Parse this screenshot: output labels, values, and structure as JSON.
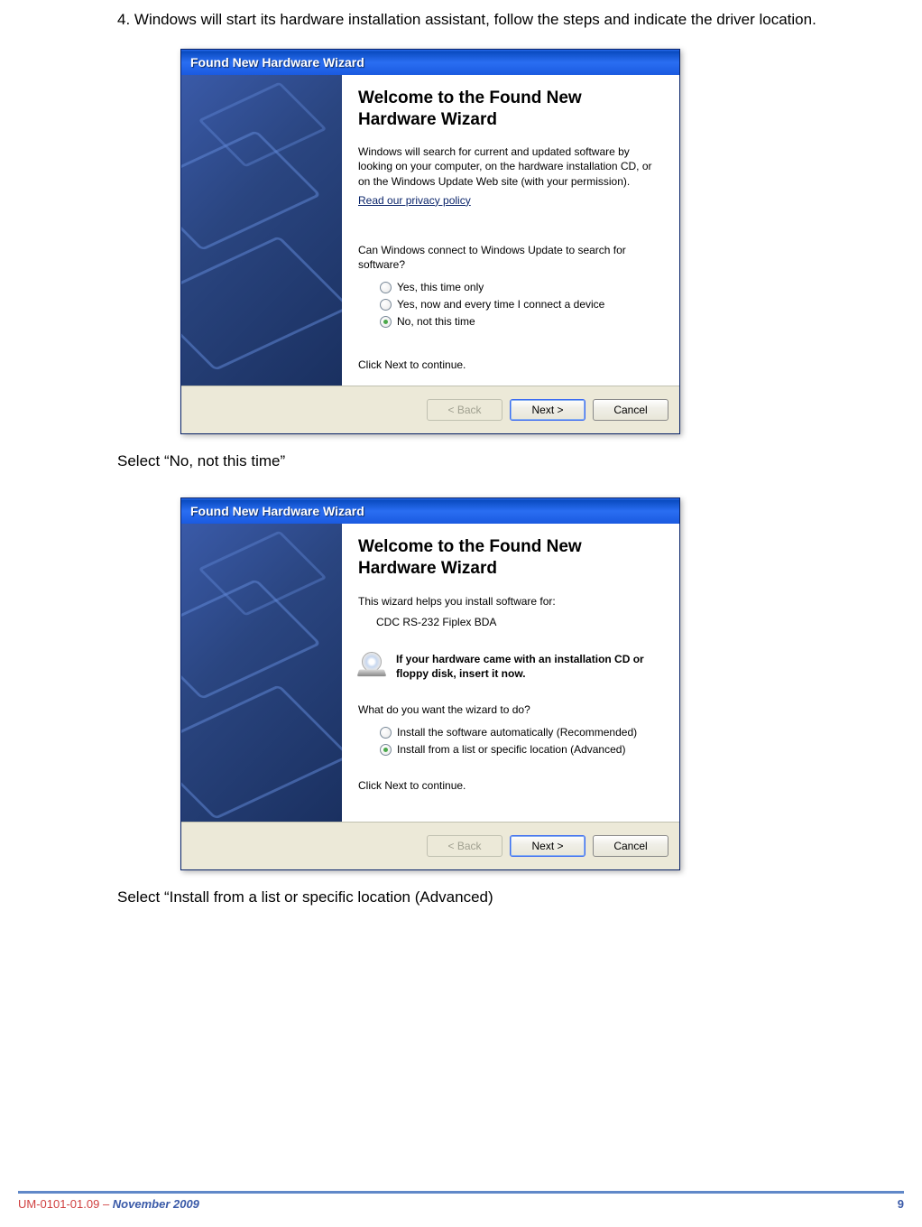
{
  "instruction_step4": "4. Windows will start its hardware installation assistant, follow the steps and indicate the driver location.",
  "caption1": "Select “No, not this time”",
  "caption2": "Select “Install from a list or specific location (Advanced)",
  "dialog1": {
    "title": "Found New Hardware Wizard",
    "heading": "Welcome to the Found New Hardware Wizard",
    "intro": "Windows will search for current and updated software by looking on your computer, on the hardware installation CD, or on the Windows Update Web site (with your permission).",
    "privacy_link": "Read our privacy policy",
    "question": "Can Windows connect to Windows Update to search for software?",
    "options": [
      {
        "label": "Yes, this time only",
        "selected": false
      },
      {
        "label": "Yes, now and every time I connect a device",
        "selected": false
      },
      {
        "label": "No, not this time",
        "selected": true
      }
    ],
    "continue": "Click Next to continue.",
    "buttons": {
      "back": "< Back",
      "next": "Next >",
      "cancel": "Cancel"
    }
  },
  "dialog2": {
    "title": "Found New Hardware Wizard",
    "heading": "Welcome to the Found New Hardware Wizard",
    "intro": "This wizard helps you install software for:",
    "device": "CDC RS-232 Fiplex BDA",
    "cd_prompt": "If your hardware came with an installation CD or floppy disk, insert it now.",
    "question": "What do you want the wizard to do?",
    "options": [
      {
        "label": "Install the software automatically (Recommended)",
        "selected": false
      },
      {
        "label": "Install from a list or specific location (Advanced)",
        "selected": true
      }
    ],
    "continue": "Click Next to continue.",
    "buttons": {
      "back": "< Back",
      "next": "Next >",
      "cancel": "Cancel"
    }
  },
  "footer": {
    "doc_id": "UM-0101-01.09",
    "sep": " – ",
    "date": "November 2009",
    "page": "9"
  }
}
